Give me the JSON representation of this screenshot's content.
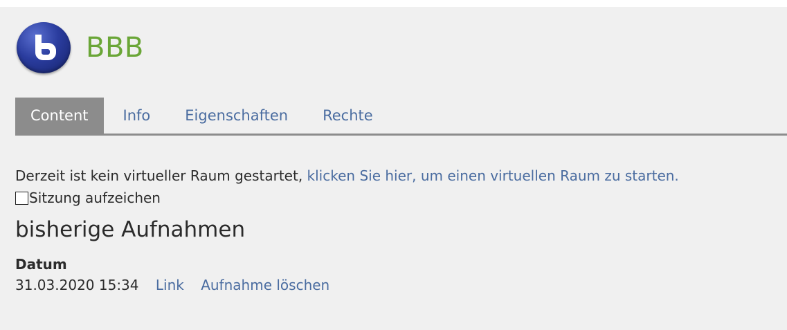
{
  "app": {
    "title": "BBB",
    "logo_icon": "bigbluebutton-logo-icon"
  },
  "tabs": [
    {
      "label": "Content",
      "active": true
    },
    {
      "label": "Info",
      "active": false
    },
    {
      "label": "Eigenschaften",
      "active": false
    },
    {
      "label": "Rechte",
      "active": false
    }
  ],
  "status": {
    "text": "Derzeit ist kein virtueller Raum gestartet,",
    "link": "klicken Sie hier, um einen virtuellen Raum zu starten."
  },
  "record": {
    "label": "Sitzung aufzeichen",
    "checked": false
  },
  "recordings": {
    "heading": "bisherige Aufnahmen",
    "column_header": "Datum",
    "rows": [
      {
        "date": "31.03.2020 15:34",
        "link_label": "Link",
        "delete_label": "Aufnahme löschen"
      }
    ]
  },
  "colors": {
    "accent_green": "#6aa637",
    "link_blue": "#4a6ca0",
    "tab_active_bg": "#8c8c8c"
  }
}
